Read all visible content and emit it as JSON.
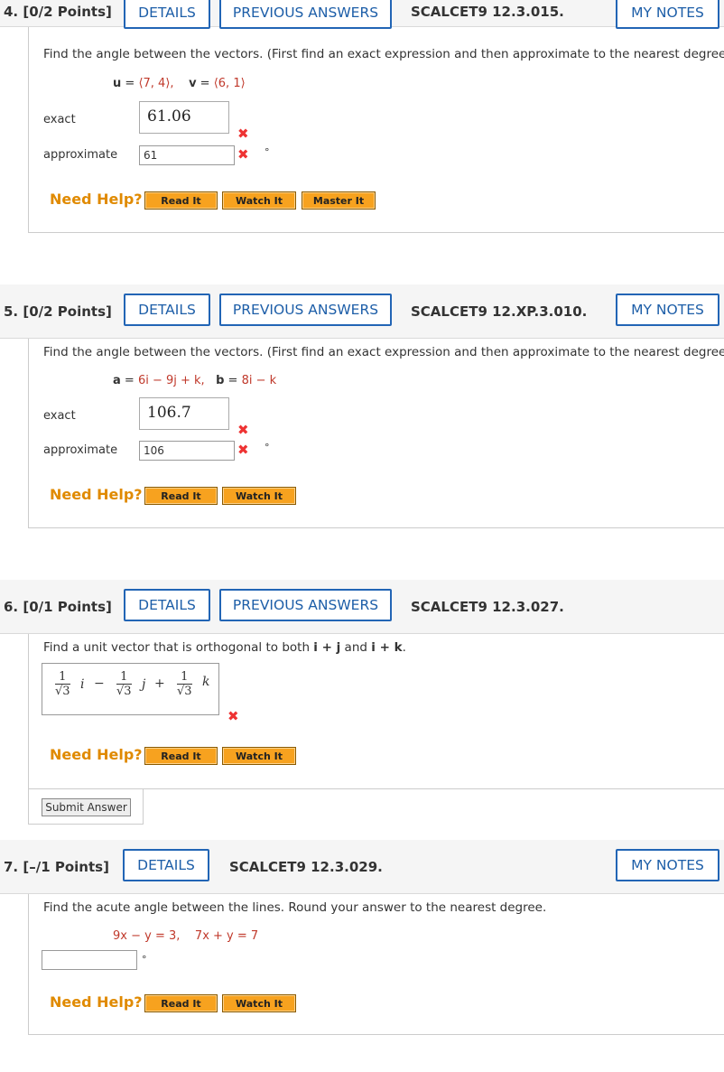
{
  "q4": {
    "number": "4. [0/2 Points]",
    "details": "DETAILS",
    "previous": "PREVIOUS ANSWERS",
    "code": "SCALCET9 12.3.015.",
    "my_notes": "MY NOTES",
    "prompt": "Find the angle between the vectors. (First find an exact expression and then approximate to the nearest degree.)",
    "u_label": "u",
    "u_value": "⟨7, 4⟩,",
    "v_label": "v",
    "v_value": "⟨6, 1⟩",
    "exact_label": "exact",
    "exact_value": "61.06",
    "approx_label": "approximate",
    "approx_value": "61",
    "deg": "°",
    "need_help": "Need Help?",
    "read_it": "Read It",
    "watch_it": "Watch It",
    "master_it": "Master It"
  },
  "q5": {
    "number": "5. [0/2 Points]",
    "details": "DETAILS",
    "previous": "PREVIOUS ANSWERS",
    "code": "SCALCET9 12.XP.3.010.",
    "my_notes": "MY NOTES",
    "prompt": "Find the angle between the vectors. (First find an exact expression and then approximate to the nearest degree.)",
    "a_label": "a",
    "a_value": "6i − 9j + k,",
    "b_label": "b",
    "b_value": "8i − k",
    "exact_label": "exact",
    "exact_value": "106.7",
    "approx_label": "approximate",
    "approx_value": "106",
    "deg": "°",
    "need_help": "Need Help?",
    "read_it": "Read It",
    "watch_it": "Watch It"
  },
  "q6": {
    "number": "6. [0/1 Points]",
    "details": "DETAILS",
    "previous": "PREVIOUS ANSWERS",
    "code": "SCALCET9 12.3.027.",
    "prompt_start": "Find a unit vector that is orthogonal to both ",
    "prompt_v1": "i + j",
    "prompt_and": " and ",
    "prompt_v2": "i + k",
    "prompt_end": ".",
    "answer": {
      "num1": "1",
      "den1": "√3",
      "var1": "i",
      "op1": "−",
      "num2": "1",
      "den2": "√3",
      "var2": "j",
      "op2": "+",
      "num3": "1",
      "den3": "√3",
      "var3": "k"
    },
    "need_help": "Need Help?",
    "read_it": "Read It",
    "watch_it": "Watch It",
    "submit": "Submit Answer"
  },
  "q7": {
    "number": "7. [–/1 Points]",
    "details": "DETAILS",
    "code": "SCALCET9 12.3.029.",
    "my_notes": "MY NOTES",
    "prompt": "Find the acute angle between the lines. Round your answer to the nearest degree.",
    "line1": "9x − y = 3,",
    "line2": "7x + y = 7",
    "deg": "°",
    "need_help": "Need Help?",
    "read_it": "Read It",
    "watch_it": "Watch It"
  },
  "colors": {
    "accent": "#2265b5",
    "orange": "#f7a21f",
    "error": "#e33333",
    "help": "#e08a00"
  }
}
